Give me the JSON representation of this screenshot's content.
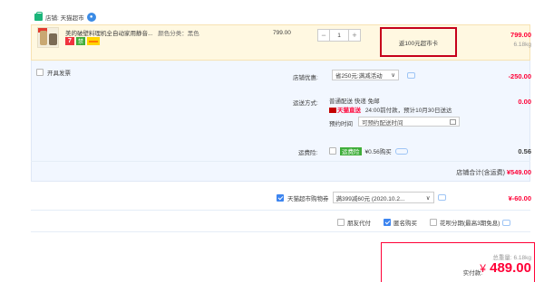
{
  "store": {
    "label": "店铺: 天猫超市"
  },
  "item": {
    "title": "美的破壁料理机全自动家用静音...",
    "category": "颜色分类：黑色",
    "tag7": "7",
    "tagg": "禁",
    "unit_price": "799.00",
    "quantity": "1",
    "minus": "−",
    "plus": "+",
    "gift": "返100元超市卡",
    "price": "799.00",
    "weight": "6.18kg"
  },
  "invoice": {
    "label": "开具发票"
  },
  "promo": {
    "label": "店铺优惠:",
    "selected": "省250元:满减活动",
    "amount": "-250.00"
  },
  "shipping": {
    "label": "运送方式:",
    "method": "普通配送 快递 免邮",
    "tmall_tag": "天猫直送",
    "eta": "24:00前付款，预计10月30日送达",
    "reserve_label": "预约时间",
    "reserve_placeholder": "可预约配送时间",
    "amount": "0.00"
  },
  "insurance": {
    "label": "运费险:",
    "tag": "运费险",
    "text": "¥0.56购买",
    "amount": "0.56"
  },
  "store_total": {
    "label": "店铺合计(含运费)",
    "value": "¥549.00"
  },
  "coupon": {
    "label": "天猫超市购物券",
    "selected": "满399减60元 (2020.10.2...",
    "amount": "¥-60.00"
  },
  "options": {
    "friend_pay": "朋友代付",
    "anonymous": "匿名购买",
    "installment": "花呗分期(最高3期免息)"
  },
  "payment": {
    "total_weight": "总重量: 6.18kg",
    "label": "实付款:",
    "currency": "¥",
    "value": "489.00"
  },
  "colors": {
    "accent": "#ff0036",
    "blue": "#3d85f0",
    "store_green": "#1bb57a"
  }
}
